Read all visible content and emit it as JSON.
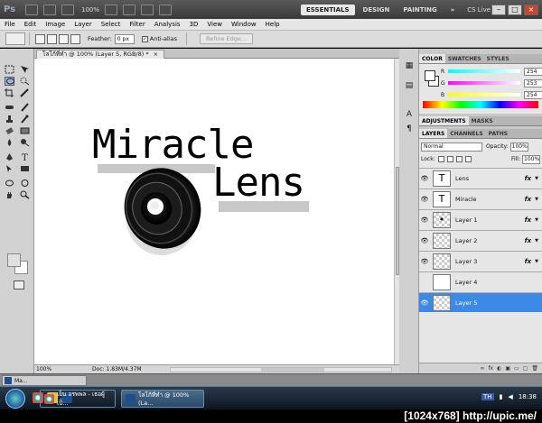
{
  "appbar": {
    "logo": "Ps",
    "zoom": "100%",
    "workspaces": [
      "ESSENTIALS",
      "DESIGN",
      "PAINTING"
    ],
    "more": "»",
    "cslive": "CS Live",
    "controls": [
      "–",
      "□",
      "×"
    ]
  },
  "menu": [
    "File",
    "Edit",
    "Image",
    "Layer",
    "Select",
    "Filter",
    "Analysis",
    "3D",
    "View",
    "Window",
    "Help"
  ],
  "options": {
    "feather_label": "Feather:",
    "feather_value": "0 px",
    "antialias_label": "Anti-alias",
    "antialias_checked": "✓",
    "refine_edge": "Refine Edge..."
  },
  "document": {
    "tab_title": "โลโก้ที่ทำ @ 100% (Layer 5, RGB/8) *",
    "tab_close": "×",
    "status_zoom": "100%",
    "status_doc": "Doc: 1.83M/4.37M",
    "artwork": {
      "line1": "Miracle",
      "line2": "Lens"
    }
  },
  "color_panel": {
    "tabs": [
      "COLOR",
      "SWATCHES",
      "STYLES"
    ],
    "channels": [
      {
        "label": "R",
        "value": "254",
        "color": "#00ffff"
      },
      {
        "label": "G",
        "value": "253",
        "color": "#ff00ff"
      },
      {
        "label": "B",
        "value": "254",
        "color": "#ffff00"
      }
    ]
  },
  "adjust_panel": {
    "tabs": [
      "ADJUSTMENTS",
      "MASKS"
    ]
  },
  "layers_panel": {
    "tabs": [
      "LAYERS",
      "CHANNELS",
      "PATHS"
    ],
    "blend_mode": "Normal",
    "opacity_label": "Opacity:",
    "opacity_value": "100%",
    "lock_label": "Lock:",
    "fill_label": "Fill:",
    "fill_value": "100%",
    "layers": [
      {
        "name": "Lens",
        "thumb": "T",
        "fx": "fx",
        "selected": false
      },
      {
        "name": "Miracle",
        "thumb": "T",
        "fx": "fx",
        "selected": false
      },
      {
        "name": "Layer 1",
        "thumb": "",
        "fx": "fx",
        "selected": false
      },
      {
        "name": "Layer 2",
        "thumb": "",
        "fx": "fx",
        "selected": false
      },
      {
        "name": "Layer 3",
        "thumb": "",
        "fx": "fx",
        "selected": false
      },
      {
        "name": "Layer 4",
        "thumb": "",
        "fx": "",
        "selected": false
      },
      {
        "name": "Layer 5",
        "thumb": "",
        "fx": "",
        "selected": true
      }
    ],
    "bottom_icons": [
      "∞",
      "fx",
      "◐",
      "▣",
      "▭",
      "▢",
      "🗑"
    ]
  },
  "minbar": {
    "doc": "Ma..."
  },
  "taskbar": {
    "tasks": [
      {
        "label": "เย็น อรพพล - เธอผู้เป็...",
        "active": false
      },
      {
        "label": "โลโก้ที่ทำ @ 100% (La...",
        "active": true
      }
    ],
    "lang": "TH",
    "time": "18:38"
  },
  "watermark": "[1024x768] http://upic.me/"
}
